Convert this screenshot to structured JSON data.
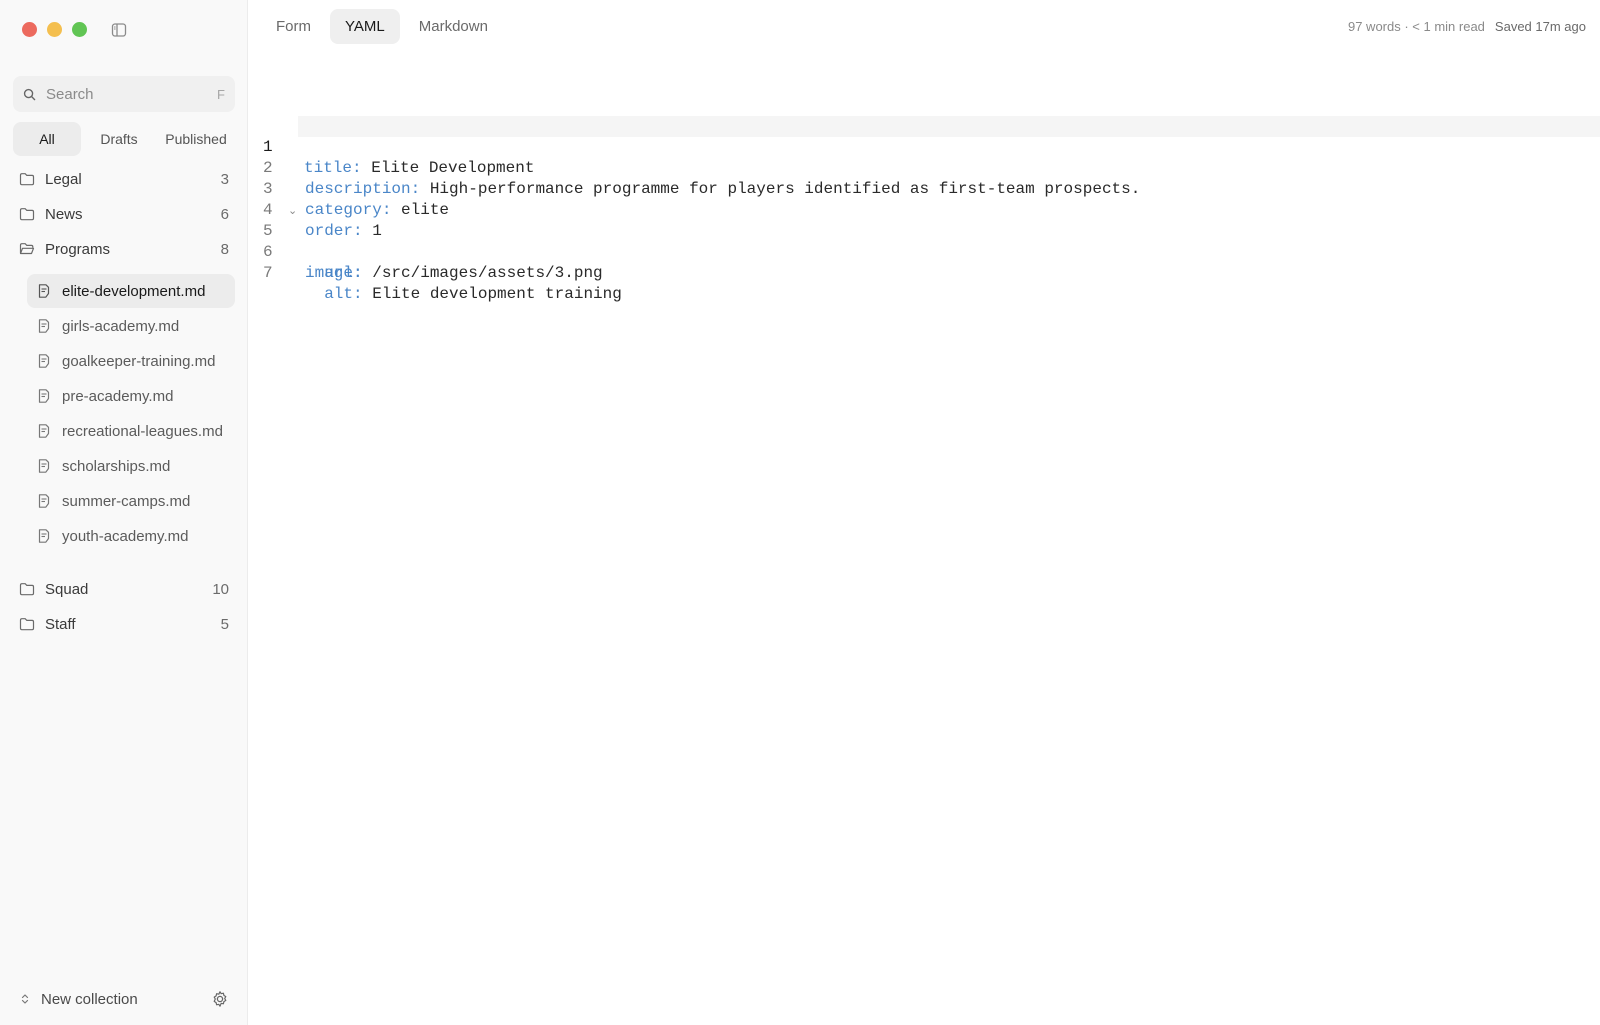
{
  "window": {
    "controls": {
      "close_color": "#ec6a5e",
      "minimize_color": "#f4bf4f",
      "maximize_color": "#61c554"
    }
  },
  "sidebar": {
    "search": {
      "placeholder": "Search",
      "shortcut": "F"
    },
    "filters": [
      "All",
      "Drafts",
      "Published"
    ],
    "active_filter": "All",
    "collections": [
      {
        "name": "Legal",
        "count": "3"
      },
      {
        "name": "News",
        "count": "6"
      },
      {
        "name": "Programs",
        "count": "8",
        "open": true
      },
      {
        "name": "Squad",
        "count": "10"
      },
      {
        "name": "Staff",
        "count": "5"
      }
    ],
    "files": [
      "elite-development.md",
      "girls-academy.md",
      "goalkeeper-training.md",
      "pre-academy.md",
      "recreational-leagues.md",
      "scholarships.md",
      "summer-camps.md",
      "youth-academy.md"
    ],
    "active_file": "elite-development.md",
    "new_collection_label": "New collection"
  },
  "main": {
    "tabs": [
      "Form",
      "YAML",
      "Markdown"
    ],
    "active_tab": "YAML",
    "stats": "97 words · < 1 min read",
    "saved": "Saved 17m ago",
    "yaml_lines": [
      {
        "num": "1",
        "indent": "",
        "key": "title",
        "value": "Elite Development"
      },
      {
        "num": "2",
        "indent": "",
        "key": "description",
        "value": "High-performance programme for players identified as first-team prospects."
      },
      {
        "num": "3",
        "indent": "",
        "key": "category",
        "value": "elite"
      },
      {
        "num": "4",
        "indent": "",
        "key": "order",
        "value": "1"
      },
      {
        "num": "5",
        "indent": "",
        "key": "image",
        "value": "",
        "foldable": true
      },
      {
        "num": "6",
        "indent": "  ",
        "key": "url",
        "value": "/src/images/assets/3.png"
      },
      {
        "num": "7",
        "indent": "  ",
        "key": "alt",
        "value": "Elite development training"
      }
    ]
  },
  "colors": {
    "accent_key": "#4a86c8",
    "active_bg": "#ececec"
  }
}
